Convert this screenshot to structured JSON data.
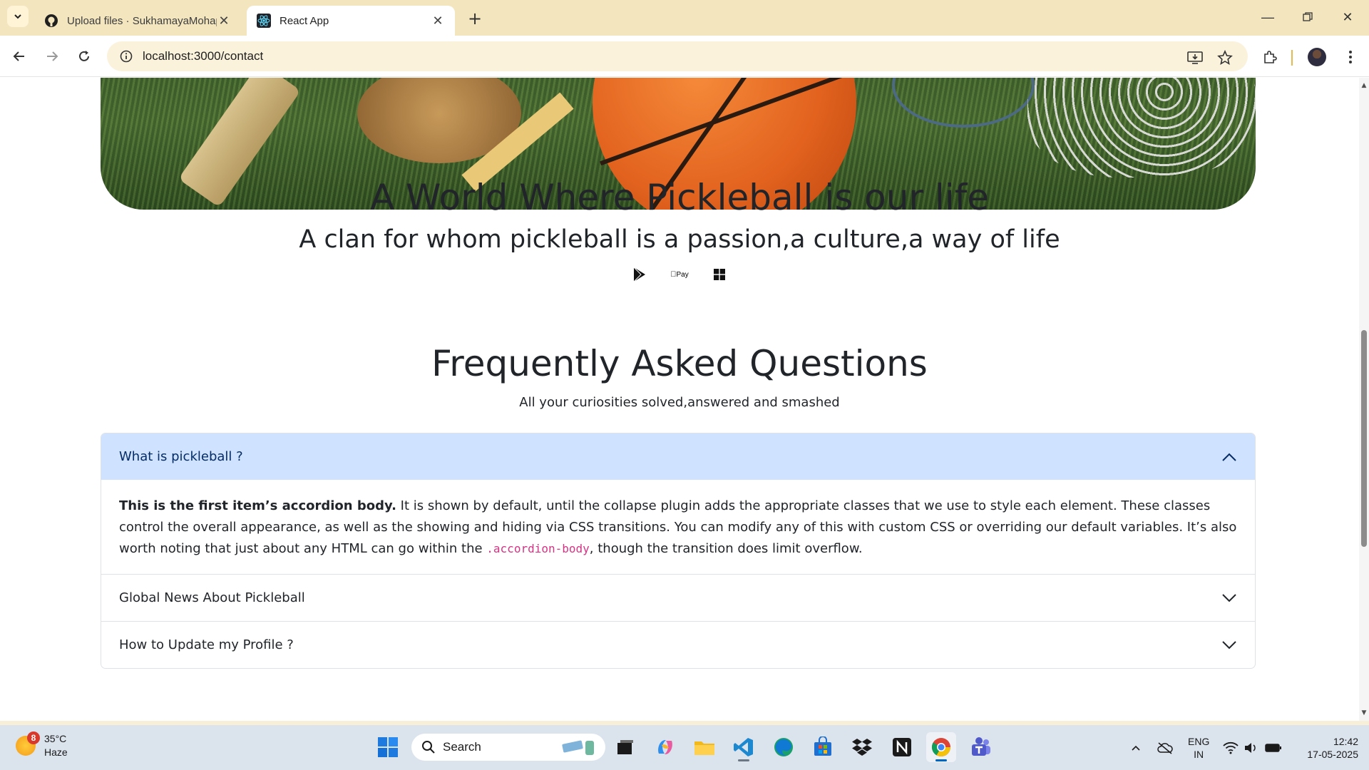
{
  "browser": {
    "tabs": [
      {
        "title": "Upload files · SukhamayaMohap",
        "active": false
      },
      {
        "title": "React App",
        "active": true
      }
    ],
    "address": "localhost:3000/contact"
  },
  "page": {
    "headline": "A World Where Pickleball is our life",
    "subheadline": "A clan for whom pickleball is a passion,a culture,a way of life",
    "badges": [
      "google-play-icon",
      "apple-pay-icon",
      "windows-icon"
    ],
    "apple_pay_text": "Pay",
    "faq_title": "Frequently Asked Questions",
    "faq_subtitle": "All your curiosities solved,answered and smashed",
    "accordion": [
      {
        "question": "What is pickleball ?",
        "expanded": true,
        "body_bold": "This is the first item’s accordion body.",
        "body_text_1": " It is shown by default, until the collapse plugin adds the appropriate classes that we use to style each element. These classes control the overall appearance, as well as the showing and hiding via CSS transitions. You can modify any of this with custom CSS or overriding our default variables. It’s also worth noting that just about any HTML can go within the ",
        "body_code": ".accordion-body",
        "body_text_2": ", though the transition does limit overflow."
      },
      {
        "question": "Global News About Pickleball",
        "expanded": false
      },
      {
        "question": "How to Update my Profile ?",
        "expanded": false
      }
    ]
  },
  "taskbar": {
    "weather_temp": "35°C",
    "weather_desc": "Haze",
    "weather_badge": "8",
    "search_label": "Search",
    "lang_line1": "ENG",
    "lang_line2": "IN",
    "time": "12:42",
    "date": "17-05-2025"
  }
}
